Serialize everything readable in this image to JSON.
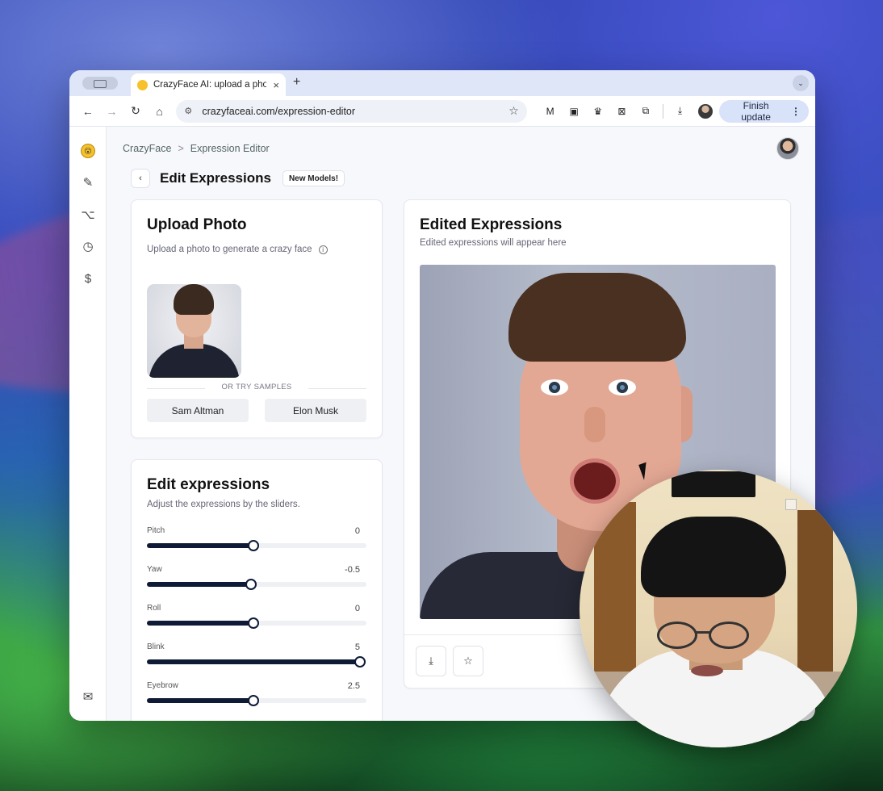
{
  "browser": {
    "tab_title": "CrazyFace AI: upload a photo",
    "tab_close": "×",
    "new_tab": "+",
    "tab_menu": "⌄",
    "url": "crazyfaceai.com/expression-editor",
    "finish_update": "Finish update",
    "extensions": [
      "M",
      "▣",
      "♛",
      "⊠",
      "⧉"
    ]
  },
  "app": {
    "breadcrumb": {
      "root": "CrazyFace",
      "separator": ">",
      "current": "Expression Editor"
    },
    "title": "Edit Expressions",
    "badge": "New Models!",
    "upload": {
      "title": "Upload Photo",
      "subtitle": "Upload a photo to generate a crazy face",
      "samples_label": "OR TRY SAMPLES",
      "samples": [
        "Sam Altman",
        "Elon Musk"
      ]
    },
    "edit": {
      "title": "Edit expressions",
      "subtitle": "Adjust the expressions by the sliders.",
      "sliders": [
        {
          "label": "Pitch",
          "value": "0",
          "fraction": 0.5
        },
        {
          "label": "Yaw",
          "value": "-0.5",
          "fraction": 0.488
        },
        {
          "label": "Roll",
          "value": "0",
          "fraction": 0.5
        },
        {
          "label": "Blink",
          "value": "5",
          "fraction": 1.0
        },
        {
          "label": "Eyebrow",
          "value": "2.5",
          "fraction": 0.5
        }
      ]
    },
    "result": {
      "title": "Edited Expressions",
      "subtitle": "Edited expressions will appear here"
    }
  },
  "colors": {
    "accent_dark": "#0e1a36",
    "favicon": "#f6c12b",
    "finish_button": "#d8e2f8"
  },
  "icons": {
    "rail": [
      "logo-icon",
      "magic-wand-icon",
      "workflow-icon",
      "history-icon",
      "dollar-icon"
    ],
    "rail_bottom": "mail-icon"
  }
}
